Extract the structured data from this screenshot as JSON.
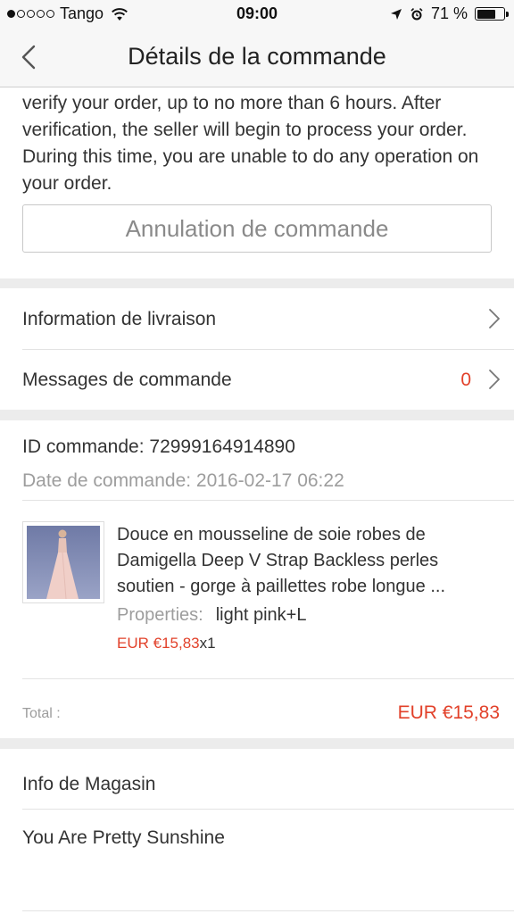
{
  "status_bar": {
    "carrier": "Tango",
    "signal_bars_filled": 1,
    "signal_bars_total": 5,
    "time": "09:00",
    "battery_percent": "71 %",
    "battery_level": 0.71
  },
  "nav": {
    "title": "Détails de la commande",
    "back_icon": "chevron-left-icon"
  },
  "notice": {
    "text": "verify your order, up to no more than 6 hours. After verification, the seller will begin to process your order. During this time, you are unable to do any operation on your order."
  },
  "cancel_button": {
    "label": "Annulation de commande"
  },
  "menu": {
    "delivery_info": "Information de livraison",
    "order_messages": "Messages de commande",
    "order_messages_count": "0"
  },
  "order": {
    "id_text": "ID commande: 72999164914890",
    "date_text": "Date de commande: 2016-02-17 06:22"
  },
  "product": {
    "title": "Douce en mousseline de soie robes de Damigella Deep V Strap Backless perles soutien - gorge à paillettes robe longue ...",
    "properties_label": "Properties:",
    "properties_value": "light pink+L",
    "price": "EUR €15,83",
    "quantity": "x1"
  },
  "total": {
    "label": "Total :",
    "value": "EUR €15,83"
  },
  "store": {
    "section_title": "Info de Magasin",
    "name": "You Are Pretty Sunshine"
  },
  "colors": {
    "accent_red": "#e2412a",
    "secondary_text": "#9d9d9d",
    "section_gap": "#ececec"
  }
}
